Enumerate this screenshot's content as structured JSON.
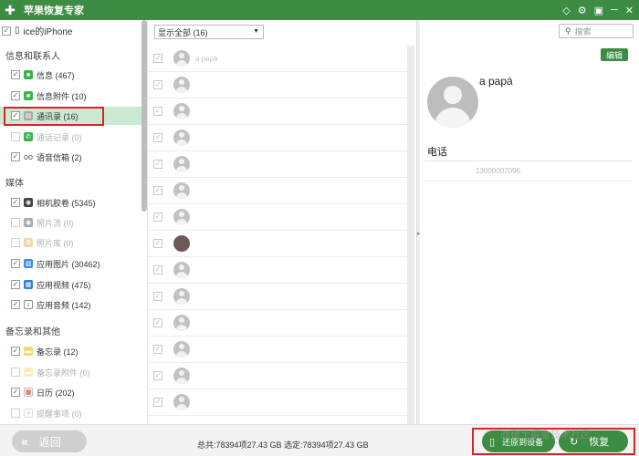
{
  "app": {
    "title": "苹果恢复专家"
  },
  "colors": {
    "brand": "#3c8c43",
    "highlight": "#c9ead0",
    "annotation": "#d9232c"
  },
  "sidebar": {
    "device": "ice的iPhone",
    "sections": [
      {
        "label": "信息和联系人",
        "items": [
          {
            "label": "信息 (467)",
            "checked": true,
            "disabled": false,
            "icon": "message-icon"
          },
          {
            "label": "信息附件 (10)",
            "checked": true,
            "disabled": false,
            "icon": "message-attachment-icon"
          },
          {
            "label": "通讯录 (16)",
            "checked": true,
            "disabled": false,
            "selected": true,
            "icon": "contacts-icon"
          },
          {
            "label": "通话记录 (0)",
            "checked": false,
            "disabled": true,
            "icon": "phone-icon"
          },
          {
            "label": "语音信箱 (2)",
            "checked": true,
            "disabled": false,
            "icon": "voicemail-icon"
          }
        ]
      },
      {
        "label": "媒体",
        "items": [
          {
            "label": "相机胶卷 (5345)",
            "checked": true,
            "disabled": false,
            "icon": "camera-icon"
          },
          {
            "label": "照片流 (0)",
            "checked": false,
            "disabled": true,
            "icon": "photo-stream-icon"
          },
          {
            "label": "照片库 (0)",
            "checked": false,
            "disabled": true,
            "icon": "photo-library-icon"
          },
          {
            "label": "应用图片 (30462)",
            "checked": true,
            "disabled": false,
            "icon": "app-photo-icon"
          },
          {
            "label": "应用视频 (475)",
            "checked": true,
            "disabled": false,
            "icon": "app-video-icon"
          },
          {
            "label": "应用音频 (142)",
            "checked": true,
            "disabled": false,
            "icon": "app-audio-icon"
          }
        ]
      },
      {
        "label": "备忘录和其他",
        "items": [
          {
            "label": "备忘录 (12)",
            "checked": true,
            "disabled": false,
            "icon": "notes-icon"
          },
          {
            "label": "备忘录附件 (0)",
            "checked": false,
            "disabled": true,
            "icon": "notes-attachment-icon"
          },
          {
            "label": "日历 (202)",
            "checked": true,
            "disabled": false,
            "icon": "calendar-icon"
          },
          {
            "label": "提醒事项 (0)",
            "checked": false,
            "disabled": true,
            "icon": "reminder-icon"
          }
        ]
      }
    ]
  },
  "middle": {
    "filter": "显示全部 (16)",
    "contacts": [
      {
        "name": "a papá",
        "photo": false
      },
      {
        "name": "",
        "photo": false
      },
      {
        "name": "",
        "photo": false
      },
      {
        "name": "",
        "photo": false
      },
      {
        "name": "",
        "photo": false
      },
      {
        "name": "",
        "photo": false
      },
      {
        "name": "",
        "photo": false
      },
      {
        "name": "",
        "photo": true
      },
      {
        "name": "",
        "photo": false
      },
      {
        "name": "",
        "photo": false
      },
      {
        "name": "",
        "photo": false
      },
      {
        "name": "",
        "photo": false
      },
      {
        "name": "",
        "photo": false
      },
      {
        "name": "",
        "photo": false
      }
    ]
  },
  "detail": {
    "search_placeholder": "搜索",
    "edit_label": "编辑",
    "contact_name": "a papá",
    "phone_label": "电话",
    "phone_value": "13000007096"
  },
  "footer": {
    "back_label": "返回",
    "status": "总共:78394项27.43 GB 选定:78394项27.43 GB",
    "restore_device_label": "还原到设备",
    "restore_label": "恢复",
    "watermark": "@稀土掘金技术社区"
  }
}
